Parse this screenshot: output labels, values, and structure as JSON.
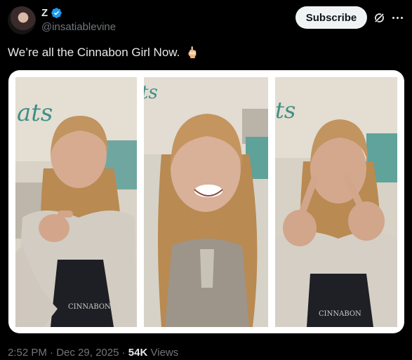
{
  "author": {
    "display_name": "Z",
    "handle": "@insatiablevine",
    "avatar_icon": "profile-avatar",
    "verified_icon": "verified-badge-icon",
    "verified_color": "#1d9bf0"
  },
  "actions": {
    "subscribe_label": "Subscribe",
    "grok_icon": "grok-icon",
    "more_icon": "more-options-icon"
  },
  "tweet": {
    "text": "We’re all the Cinnabon Girl Now.",
    "emoji": "🖕🏻"
  },
  "media": {
    "panel_1_apron_text": "CINNABON",
    "panel_3_apron_text": "CINNABON",
    "sign_text": "ats"
  },
  "meta": {
    "time": "2:52 PM",
    "separator": "·",
    "date": "Dec 29, 2025",
    "views_count": "54K",
    "views_label": "Views"
  },
  "colors": {
    "background": "#000000",
    "text_primary": "#e7e9ea",
    "text_secondary": "#71767b",
    "button_bg": "#eff3f4"
  }
}
